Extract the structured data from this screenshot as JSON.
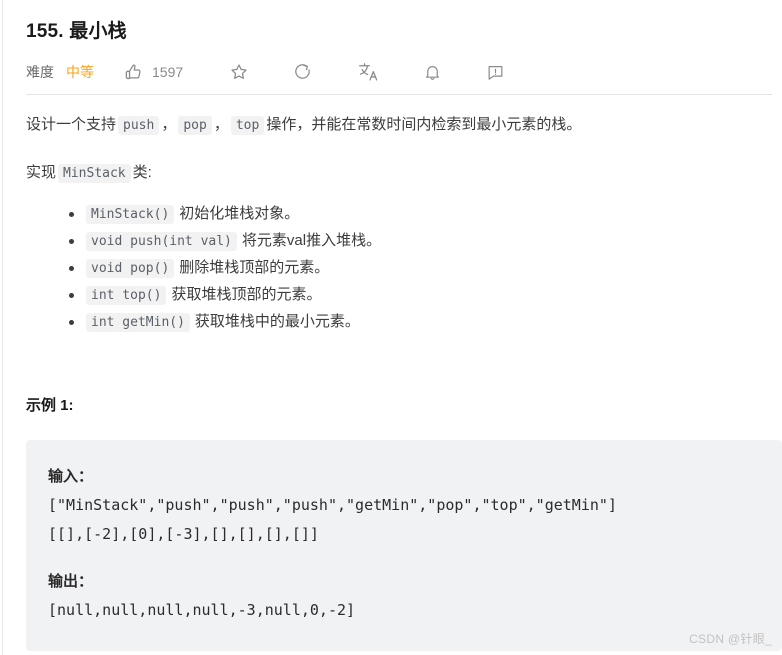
{
  "problem": {
    "title": "155. 最小栈",
    "difficulty_label": "难度",
    "difficulty_value": "中等",
    "like_count": "1597"
  },
  "toolbar": {
    "icons": [
      {
        "name": "thumbs-up-icon",
        "label": "点赞"
      },
      {
        "name": "star-icon",
        "label": "收藏"
      },
      {
        "name": "share-icon",
        "label": "分享"
      },
      {
        "name": "translate-icon",
        "label": "翻译"
      },
      {
        "name": "bell-icon",
        "label": "提醒"
      },
      {
        "name": "comment-icon",
        "label": "反馈"
      }
    ],
    "translate_glyph": "文A"
  },
  "description": {
    "line1_prefix": "设计一个支持",
    "code_push": "push",
    "comma1": "，",
    "code_pop": "pop",
    "comma2": "，",
    "code_top": "top",
    "line1_suffix": "操作，并能在常数时间内检索到最小元素的栈。",
    "line2_prefix": "实现",
    "code_minstack": "MinStack",
    "line2_suffix": "类:"
  },
  "methods": [
    {
      "signature": "MinStack()",
      "desc": "初始化堆栈对象。"
    },
    {
      "signature": "void push(int val)",
      "desc": "将元素val推入堆栈。"
    },
    {
      "signature": "void pop()",
      "desc": "删除堆栈顶部的元素。"
    },
    {
      "signature": "int top()",
      "desc": "获取堆栈顶部的元素。"
    },
    {
      "signature": "int getMin()",
      "desc": "获取堆栈中的最小元素。"
    }
  ],
  "example": {
    "heading": "示例 1:",
    "input_label": "输入：",
    "input_line1": "[\"MinStack\",\"push\",\"push\",\"push\",\"getMin\",\"pop\",\"top\",\"getMin\"]",
    "input_line2": "[[],[-2],[0],[-3],[],[],[],[]]",
    "output_label": "输出：",
    "output_line1": "[null,null,null,null,-3,null,0,-2]"
  },
  "watermark": {
    "text": "CSDN @针眼_"
  },
  "colors": {
    "difficulty_medium": "#ffa116",
    "code_block_bg": "#f1f2f4",
    "inline_code_bg": "#f2f2f2",
    "text": "#3c3c3c",
    "muted": "#8a8a8a"
  }
}
